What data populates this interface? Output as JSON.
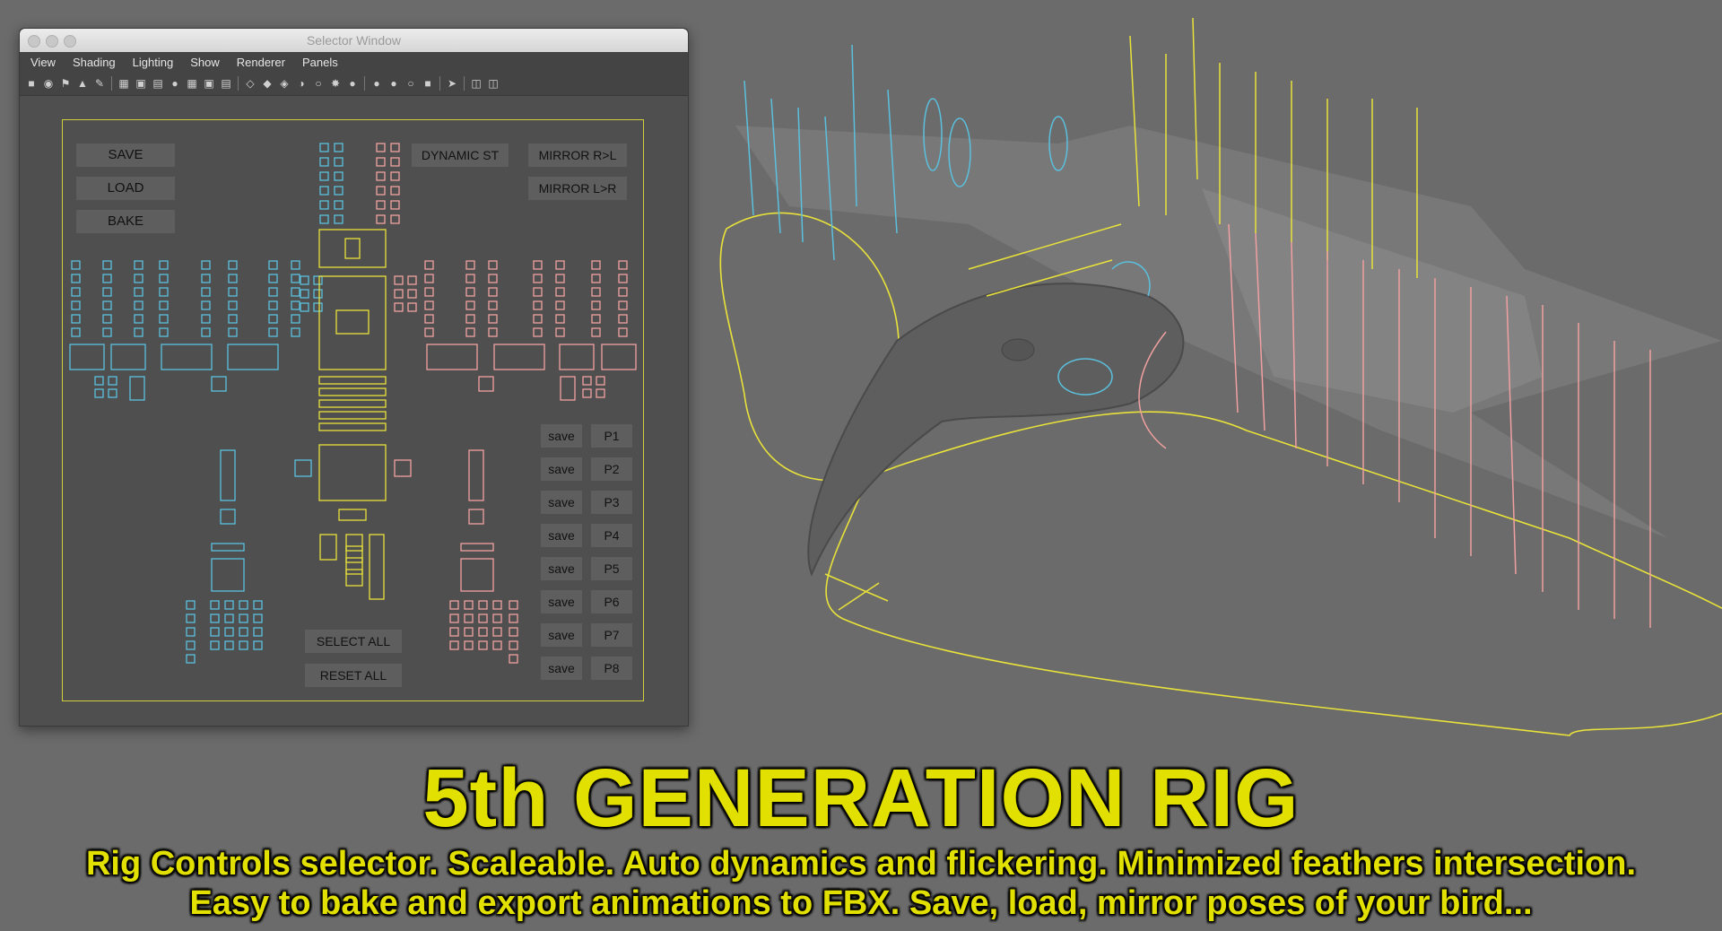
{
  "window": {
    "title": "Selector Window",
    "menu": [
      "View",
      "Shading",
      "Lighting",
      "Show",
      "Renderer",
      "Panels"
    ]
  },
  "selector": {
    "save_label": "SAVE",
    "load_label": "LOAD",
    "bake_label": "BAKE",
    "dynamic_label": "DYNAMIC ST",
    "mirror_rl_label": "MIRROR R>L",
    "mirror_lr_label": "MIRROR L>R",
    "select_all_label": "SELECT ALL",
    "reset_all_label": "RESET ALL",
    "poses": [
      {
        "save": "save",
        "pose": "P1"
      },
      {
        "save": "save",
        "pose": "P2"
      },
      {
        "save": "save",
        "pose": "P3"
      },
      {
        "save": "save",
        "pose": "P4"
      },
      {
        "save": "save",
        "pose": "P5"
      },
      {
        "save": "save",
        "pose": "P6"
      },
      {
        "save": "save",
        "pose": "P7"
      },
      {
        "save": "save",
        "pose": "P8"
      }
    ]
  },
  "banner": {
    "headline": "5th GENERATION RIG",
    "line1": "Rig Controls selector. Scaleable. Auto dynamics and flickering. Minimized feathers intersection.",
    "line2": "Easy to bake and export animations to FBX. Save, load, mirror poses of your bird..."
  },
  "colors": {
    "background": "#6b6b6b",
    "left_controls": "#5bc0de",
    "right_controls": "#f0a0a0",
    "center_controls": "#e8e23a",
    "headline": "#e2e000"
  },
  "viewport": {
    "icons": [
      "bird-model",
      "feather-controls-left",
      "feather-controls-right",
      "wing-outline-curve"
    ]
  }
}
